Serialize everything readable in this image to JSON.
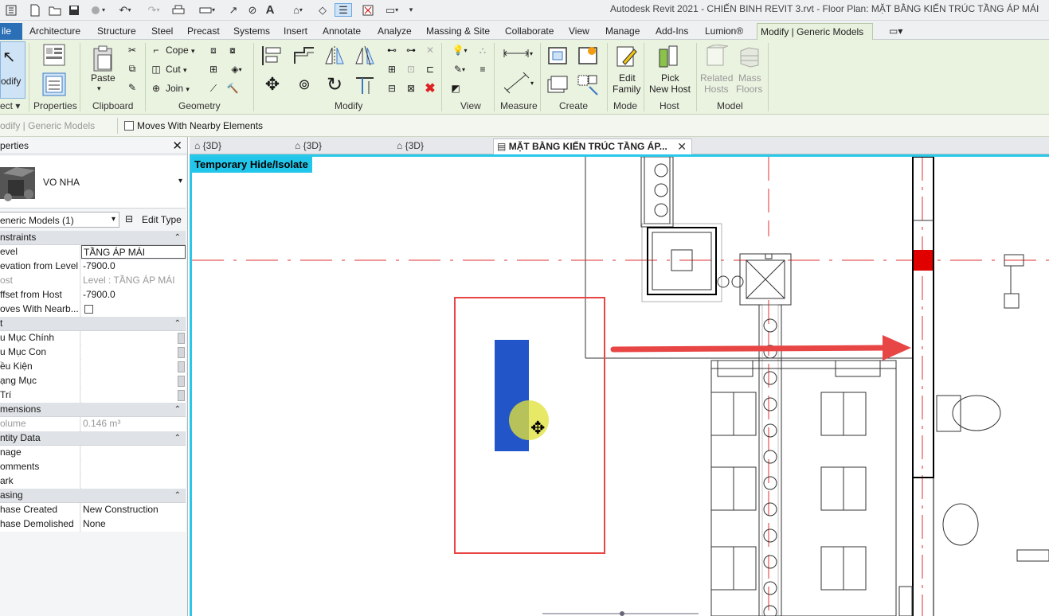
{
  "title": "Autodesk Revit 2021 - CHIẾN BINH REVIT 3.rvt - Floor Plan: MẶT BẰNG KIẾN TRÚC TẦNG ÁP MÁI",
  "tabs": [
    "ile",
    "Architecture",
    "Structure",
    "Steel",
    "Precast",
    "Systems",
    "Insert",
    "Annotate",
    "Analyze",
    "Massing & Site",
    "Collaborate",
    "View",
    "Manage",
    "Add-Ins",
    "Lumion®",
    "Modify | Generic Models"
  ],
  "ribbon": {
    "modify": "odify",
    "select": "ect",
    "properties": "Properties",
    "paste": "Paste",
    "clipboard": "Clipboard",
    "cope": "Cope",
    "cut": "Cut",
    "join": "Join",
    "geometry": "Geometry",
    "modify_panel": "Modify",
    "view_panel": "View",
    "measure": "Measure",
    "create": "Create",
    "edit_family": [
      "Edit",
      "Family"
    ],
    "pick_new_host": [
      "Pick",
      "New Host"
    ],
    "related_hosts": [
      "Related",
      "Hosts"
    ],
    "mass_floors": [
      "Mass",
      "Floors"
    ],
    "mode": "Mode",
    "host": "Host",
    "model": "Model"
  },
  "optionsbar": {
    "context": "odify | Generic Models",
    "moves_with_nearby": "Moves With Nearby Elements"
  },
  "properties": {
    "title": "perties",
    "type_name": "VO NHA",
    "selector": "eneric Models (1)",
    "edit_type": "Edit Type",
    "sections": {
      "constraints": "nstraints",
      "text": "t",
      "dimensions": "mensions",
      "identity": "ntity Data",
      "phasing": "asing"
    },
    "rows": {
      "level": [
        "evel",
        "TẦNG ÁP MÁI"
      ],
      "elev": [
        "evation from Level",
        "-7900.0"
      ],
      "host": [
        "ost",
        "Level : TẦNG ÁP MÁI"
      ],
      "offset": [
        "ffset from Host",
        "-7900.0"
      ],
      "moves": [
        "oves With Nearb...",
        ""
      ],
      "r1": [
        "u Mục Chính",
        ""
      ],
      "r2": [
        "u Mục Con",
        ""
      ],
      "r3": [
        "ều Kiện",
        ""
      ],
      "r4": [
        "ạng Mục",
        ""
      ],
      "r5": [
        "Trí",
        ""
      ],
      "volume": [
        "olume",
        "0.146 m³"
      ],
      "image": [
        "nage",
        ""
      ],
      "comments": [
        "omments",
        ""
      ],
      "mark": [
        "ark",
        ""
      ],
      "phase_created": [
        "hase Created",
        "New Construction"
      ],
      "phase_demolished": [
        "hase Demolished",
        "None"
      ]
    }
  },
  "viewtabs": [
    "{3D}",
    "{3D}",
    "{3D}",
    "MẶT BẰNG KIẾN TRÚC TẦNG ÁP..."
  ],
  "canvas": {
    "banner": "Temporary Hide/Isolate"
  },
  "colors": {
    "accent": "#22c6ea",
    "selected_element": "#2255c7",
    "highlight_box": "#e84545",
    "arrow": "#e84545"
  }
}
